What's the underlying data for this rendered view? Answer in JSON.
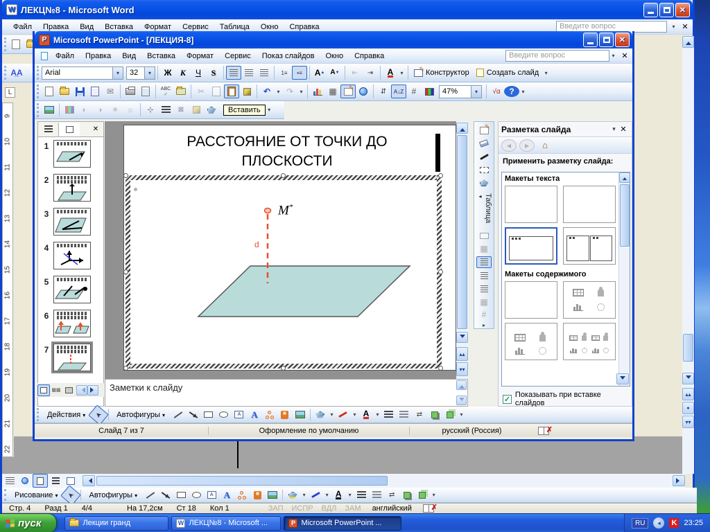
{
  "glyphs": {
    "dropdown": "▾",
    "close": "✕",
    "up": "▴",
    "down": "▾",
    "left": "◂",
    "right": "▸",
    "scissors": "✂",
    "undo": "↶",
    "redo": "↷",
    "table_grid": "▦",
    "grid": "#",
    "sqrt": "√α",
    "help": "?",
    "check": "✓",
    "home": "⌂",
    "dot": "●",
    "word_logo": "W",
    "ppt_logo": "P",
    "double_up": "▴▴",
    "double_down": "▾▾",
    "abc": "ABC",
    "az": "A↓Z",
    "pointer": "➤"
  },
  "word": {
    "title": "ЛЕКЦ№8 - Microsoft Word",
    "menu": [
      "Файл",
      "Правка",
      "Вид",
      "Вставка",
      "Формат",
      "Сервис",
      "Таблица",
      "Окно",
      "Справка"
    ],
    "ask_placeholder": "Введите вопрос",
    "styles_icon": "А̲А",
    "ruler_tab": "L",
    "ruler_numbers": [
      "9",
      "10",
      "11",
      "12",
      "13",
      "14",
      "15",
      "16",
      "17",
      "18",
      "19",
      "20",
      "21",
      "22"
    ],
    "drawing": {
      "actions_label": "Рисование",
      "autoshapes_label": "Автофигуры"
    },
    "status": {
      "page": "Стр. 4",
      "section": "Разд 1",
      "position": "4/4",
      "at": "На 17,2см",
      "line": "Ст 18",
      "column": "Кол 1",
      "flags": [
        "ЗАП",
        "ИСПР",
        "ВДЛ",
        "ЗАМ"
      ],
      "language": "английский"
    }
  },
  "powerpoint": {
    "title": "Microsoft PowerPoint - [ЛЕКЦИЯ-8]",
    "menu": [
      "Файл",
      "Правка",
      "Вид",
      "Вставка",
      "Формат",
      "Сервис",
      "Показ слайдов",
      "Окно",
      "Справка"
    ],
    "ask_placeholder": "Введите вопрос",
    "formatting": {
      "font": "Arial",
      "size": "32",
      "bold": "Ж",
      "italic": "К",
      "underline": "Ч",
      "shadow": "S",
      "font_color": "A",
      "designer_label": "Конструктор",
      "new_slide_label": "Создать слайд"
    },
    "standard": {
      "zoom": "47%"
    },
    "picture_tooltip": "Вставить",
    "slides_panel": {
      "numbers": [
        "1",
        "2",
        "3",
        "4",
        "5",
        "6",
        "7"
      ],
      "selected": "7"
    },
    "slide": {
      "title": "РАССТОЯНИЕ ОТ ТОЧКИ ДО ПЛОСКОСТИ",
      "point_label": "M",
      "point_sup": "*",
      "distance_label": "d",
      "plane_fill": "#b9dcda",
      "dash_color": "#e8502c"
    },
    "notes_placeholder": "Заметки к слайду",
    "tables_toolbar_label": "Таблица",
    "taskpane": {
      "title": "Разметка слайда",
      "apply_label": "Применить разметку слайда:",
      "section_text": "Макеты текста",
      "section_content": "Макеты содержимого",
      "checkbox_label": "Показывать при вставке слайдов"
    },
    "drawing": {
      "actions_label": "Действия",
      "autoshapes_label": "Автофигуры"
    },
    "status": {
      "slide": "Слайд 7 из 7",
      "design": "Оформление по умолчанию",
      "language": "русский (Россия)"
    }
  },
  "taskbar": {
    "start_label": "пуск",
    "buttons": [
      {
        "label": "Лекции гранд"
      },
      {
        "label": "ЛЕКЦ№8 - Microsoft ..."
      },
      {
        "label": "Microsoft PowerPoint ..."
      }
    ],
    "tray": {
      "lang": "RU",
      "clock": "23:25",
      "av_letter": "K"
    }
  }
}
